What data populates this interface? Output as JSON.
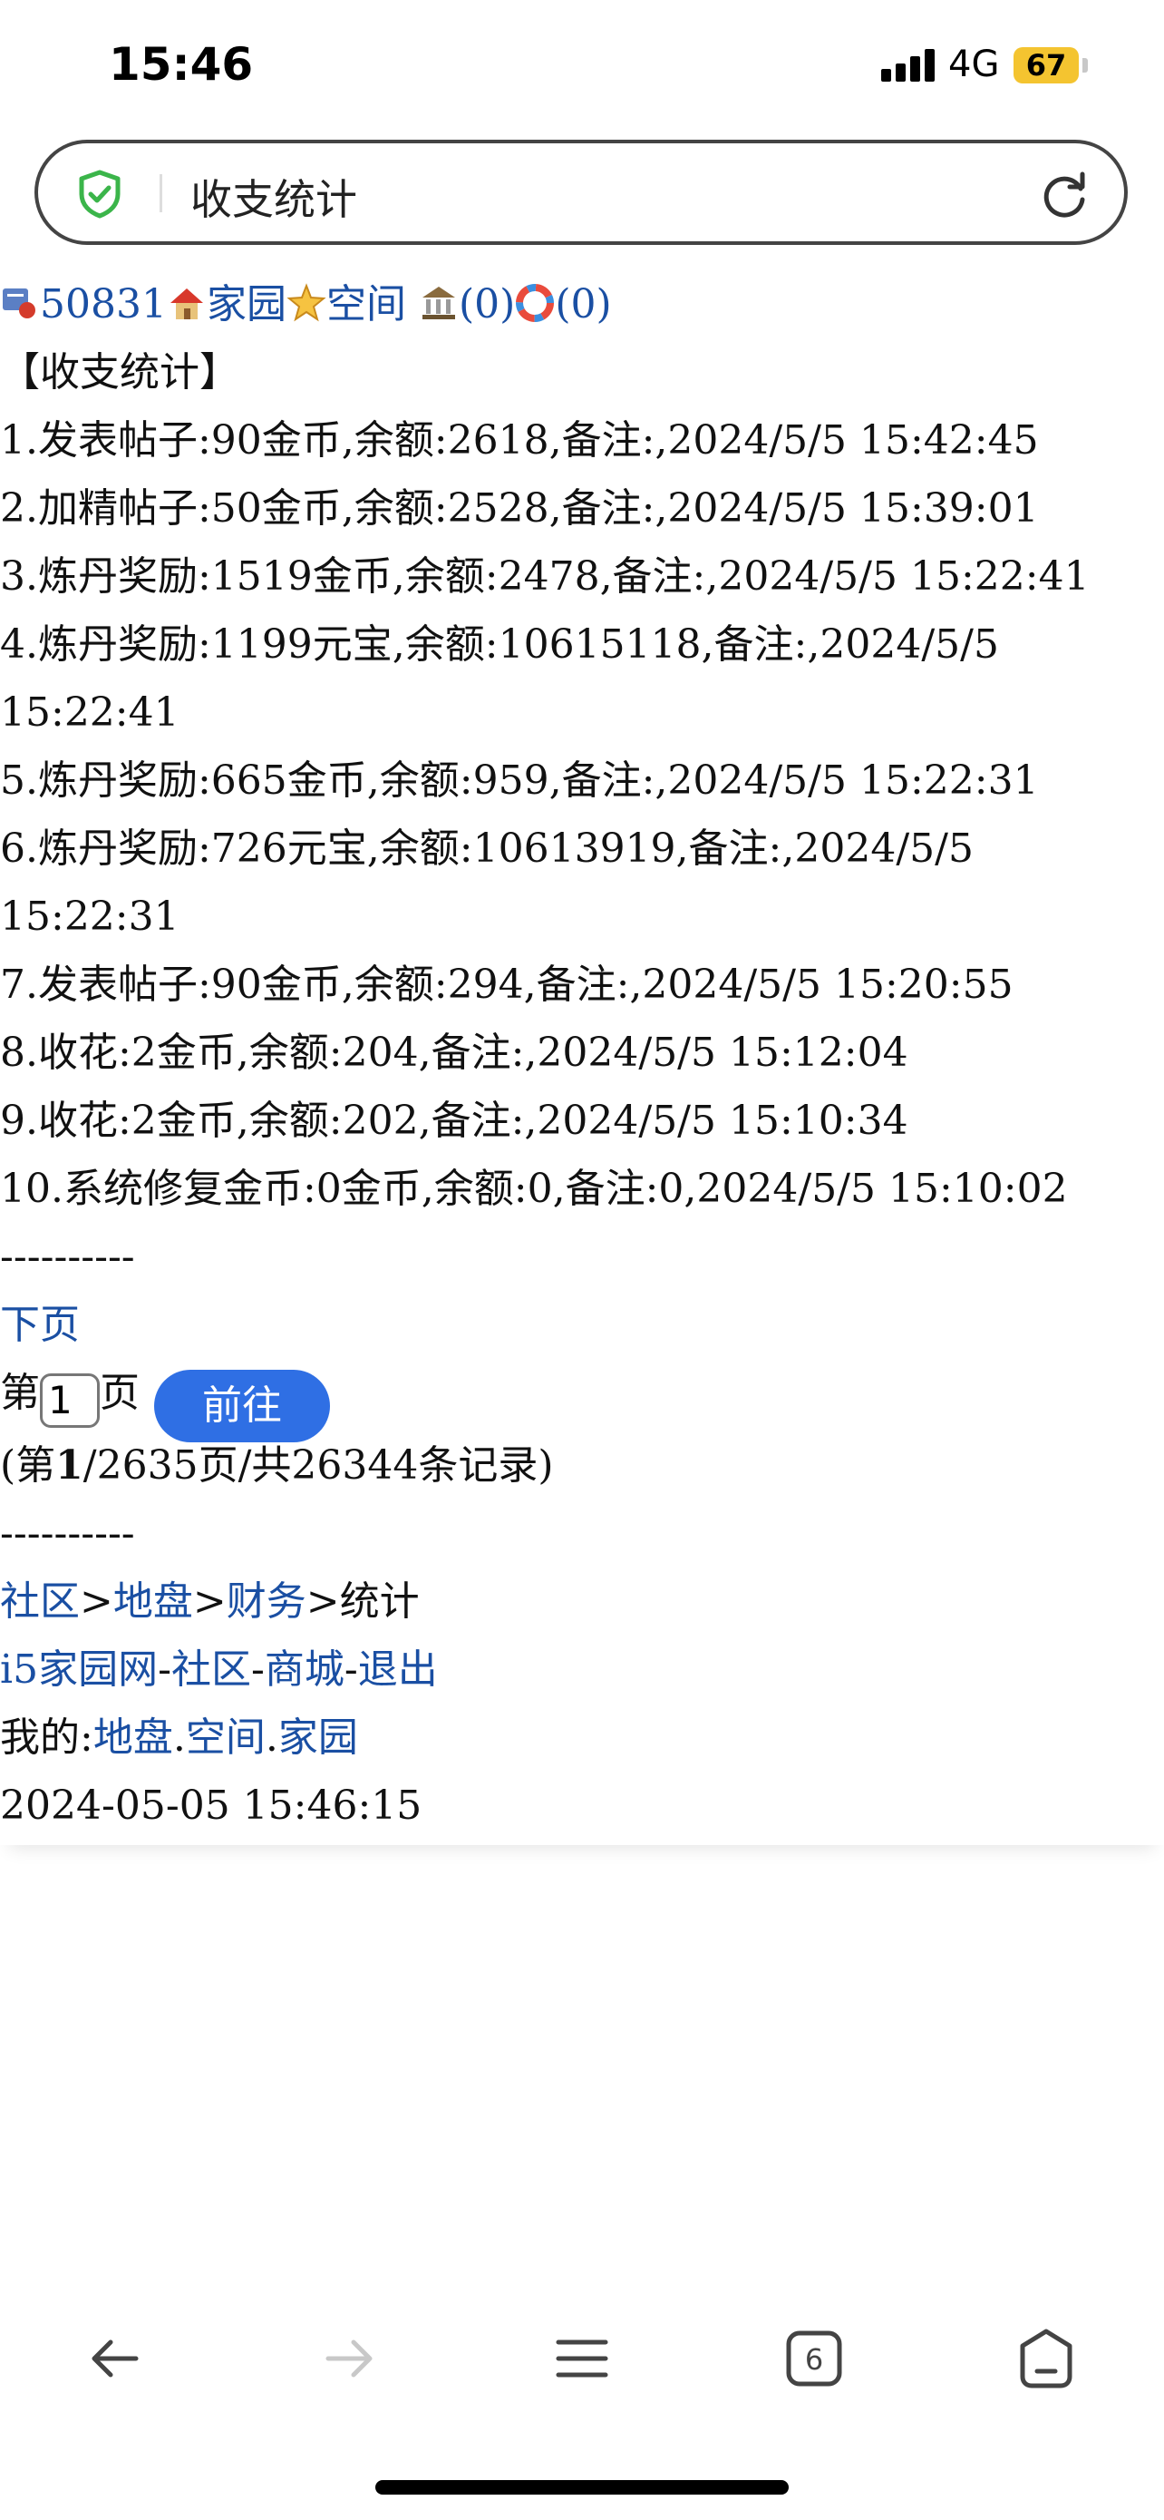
{
  "status_bar": {
    "time": "15:46",
    "network": "4G",
    "battery": "67"
  },
  "address_bar": {
    "title": "收支统计"
  },
  "user_row": {
    "user_id": "50831",
    "home": "家园",
    "space": "空间",
    "count1": "(0)",
    "count2": "(0)"
  },
  "heading": "【收支统计】",
  "records": [
    "1.发表帖子:90金币,余额:2618,备注:,2024/5/5 15:42:45",
    "2.加精帖子:50金币,余额:2528,备注:,2024/5/5 15:39:01",
    "3.炼丹奖励:1519金币,余额:2478,备注:,2024/5/5 15:22:41",
    "4.炼丹奖励:1199元宝,余额:10615118,备注:,2024/5/5 15:22:41",
    "5.炼丹奖励:665金币,余额:959,备注:,2024/5/5 15:22:31",
    "6.炼丹奖励:726元宝,余额:10613919,备注:,2024/5/5 15:22:31",
    "7.发表帖子:90金币,余额:294,备注:,2024/5/5 15:20:55",
    "8.收花:2金币,余额:204,备注:,2024/5/5 15:12:04",
    "9.收花:2金币,余额:202,备注:,2024/5/5 15:10:34",
    "10.系统修复金币:0金币,余额:0,备注:0,2024/5/5 15:10:02"
  ],
  "separator": "----------",
  "next_page": "下页",
  "pager": {
    "prefix": "第",
    "page_value": "1",
    "suffix": "页",
    "go_label": "前往",
    "summary_open": "(第",
    "current_page": "1",
    "summary_rest": "/2635页/共26344条记录)"
  },
  "breadcrumb": {
    "community": "社区",
    "land": "地盘",
    "finance": "财务",
    "current": "统计",
    "sep": ">"
  },
  "site_links": {
    "site": "i5家园网",
    "community": "社区",
    "mall": "商城",
    "logout": "退出",
    "sep": "-"
  },
  "mine": {
    "label": "我的:",
    "land": "地盘",
    "space": "空间",
    "home": "家园",
    "dot": "."
  },
  "timestamp": "2024-05-05 15:46:15"
}
